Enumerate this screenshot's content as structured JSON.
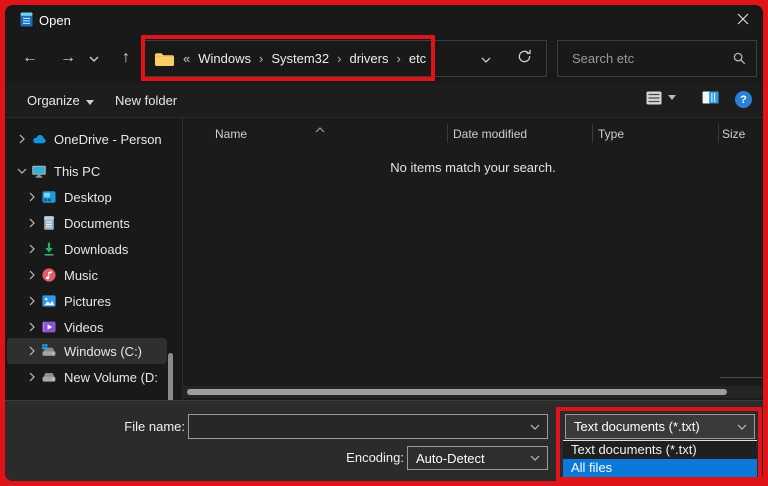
{
  "window": {
    "title": "Open"
  },
  "navbar": {
    "back_glyph": "←",
    "forward_glyph": "→",
    "up_glyph": "↑",
    "breadcrumb_prefix": "«",
    "separator": "›",
    "breadcrumb": [
      {
        "label": "Windows"
      },
      {
        "label": "System32"
      },
      {
        "label": "drivers"
      },
      {
        "label": "etc"
      }
    ],
    "search_placeholder": "Search etc"
  },
  "toolbar": {
    "organize_label": "Organize",
    "new_folder_label": "New folder",
    "help_glyph": "?"
  },
  "sidebar": {
    "items": [
      {
        "label": "OneDrive - Person",
        "icon": "onedrive-icon",
        "level": 0,
        "expanded": false,
        "selected": false
      },
      {
        "label": "This PC",
        "icon": "this-pc-icon",
        "level": 0,
        "expanded": true,
        "selected": false
      },
      {
        "label": "Desktop",
        "icon": "desktop-icon",
        "level": 1,
        "expanded": false,
        "selected": false
      },
      {
        "label": "Documents",
        "icon": "documents-icon",
        "level": 1,
        "expanded": false,
        "selected": false
      },
      {
        "label": "Downloads",
        "icon": "downloads-icon",
        "level": 1,
        "expanded": false,
        "selected": false
      },
      {
        "label": "Music",
        "icon": "music-icon",
        "level": 1,
        "expanded": false,
        "selected": false
      },
      {
        "label": "Pictures",
        "icon": "pictures-icon",
        "level": 1,
        "expanded": false,
        "selected": false
      },
      {
        "label": "Videos",
        "icon": "videos-icon",
        "level": 1,
        "expanded": false,
        "selected": false
      },
      {
        "label": "Windows (C:)",
        "icon": "drive-windows-icon",
        "level": 1,
        "expanded": false,
        "selected": true
      },
      {
        "label": "New Volume (D:",
        "icon": "drive-icon",
        "level": 1,
        "expanded": false,
        "selected": false
      }
    ]
  },
  "list": {
    "columns": [
      {
        "label": "Name"
      },
      {
        "label": "Date modified"
      },
      {
        "label": "Type"
      },
      {
        "label": "Size"
      }
    ],
    "sort_column": "Name",
    "sort_direction": "ascending",
    "empty_message": "No items match your search."
  },
  "footer": {
    "file_name_label": "File name:",
    "file_name_value": "",
    "encoding_label": "Encoding:",
    "encoding_value": "Auto-Detect",
    "file_type": {
      "selected": "Text documents (*.txt)",
      "options": [
        {
          "label": "Text documents (*.txt)",
          "highlighted": false
        },
        {
          "label": "All files",
          "highlighted": true
        }
      ]
    }
  },
  "annotations": {
    "color": "#e01318",
    "regions": [
      "address-bar-breadcrumb",
      "file-type-dropdown"
    ],
    "selection_blue": "#0a79da"
  }
}
